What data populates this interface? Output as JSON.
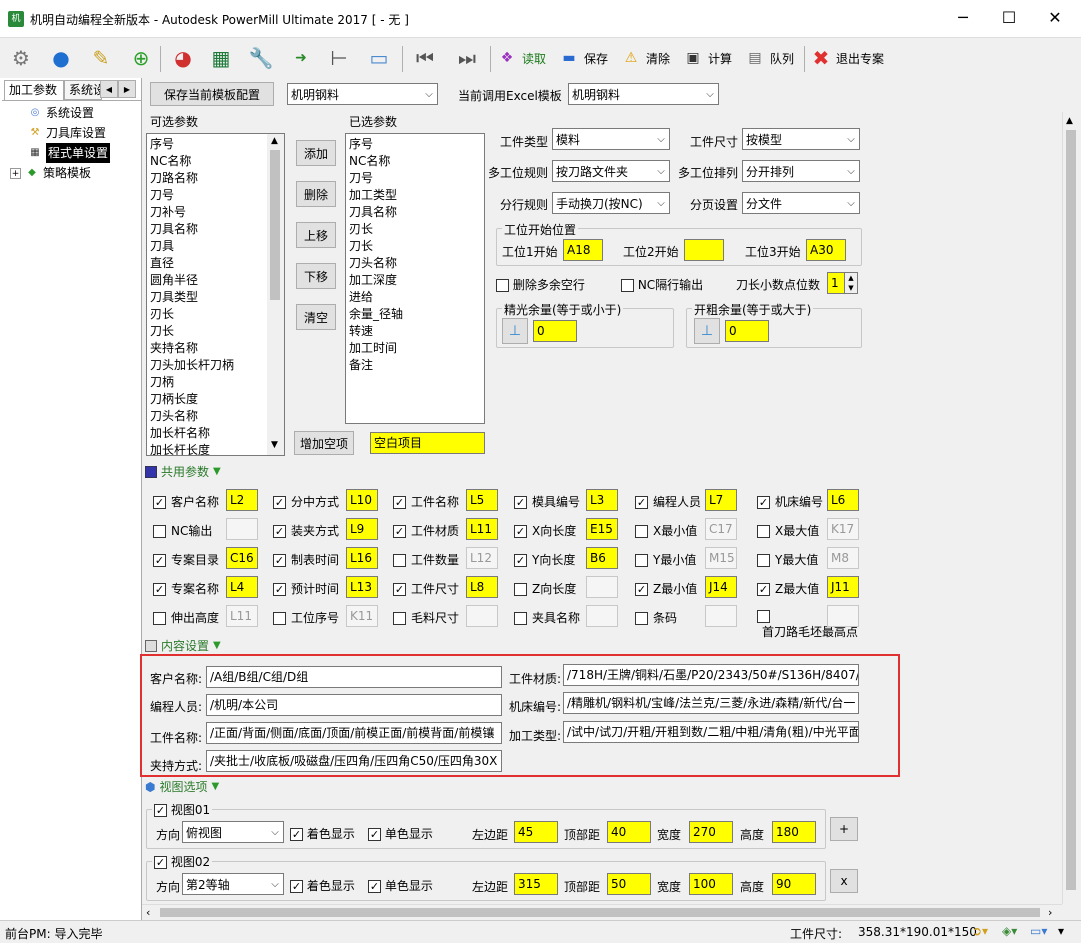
{
  "window": {
    "title": "机明自动编程全新版本 - Autodesk PowerMill Ultimate 2017 [ - 无 ]",
    "min": "─",
    "max": "☐",
    "close": "✕"
  },
  "toolbar": {
    "read": "读取",
    "save": "保存",
    "clear": "清除",
    "calc": "计算",
    "queue": "队列",
    "exit": "退出专案"
  },
  "left": {
    "tabs": [
      "加工参数",
      "系统设"
    ],
    "tree": [
      "系统设置",
      "刀具库设置",
      "程式单设置",
      "策略模板"
    ]
  },
  "top": {
    "save_btn": "保存当前模板配置",
    "template": "机明钢料",
    "excel_label": "当前调用Excel模板",
    "excel_value": "机明钢料"
  },
  "lists": {
    "avail_label": "可选参数",
    "sel_label": "已选参数",
    "available": [
      "序号",
      "NC名称",
      "刀路名称",
      "刀号",
      "刀补号",
      "刀具名称",
      "刀具",
      "直径",
      "圆角半径",
      "刀具类型",
      "刃长",
      "刀长",
      "夹持名称",
      "刀头加长杆刀柄",
      "刀柄",
      "刀柄长度",
      "刀头名称",
      "加长杆名称",
      "加长杆长度"
    ],
    "selected": [
      "序号",
      "NC名称",
      "刀号",
      "加工类型",
      "刀具名称",
      "刃长",
      "刀长",
      "刀头名称",
      "加工深度",
      "进给",
      "余量_径轴",
      "转速",
      "加工时间",
      "备注"
    ],
    "buttons": [
      "添加",
      "删除",
      "上移",
      "下移",
      "清空"
    ],
    "add_blank": "增加空项",
    "blank_value": "空白项目"
  },
  "settings": {
    "work_type_l": "工件类型",
    "work_type": "模料",
    "work_size_l": "工件尺寸",
    "work_size": "按模型",
    "multi_rule_l": "多工位规则",
    "multi_rule": "按刀路文件夹",
    "multi_order_l": "多工位排列",
    "multi_order": "分开排列",
    "split_rule_l": "分行规则",
    "split_rule": "手动换刀(按NC)",
    "page_l": "分页设置",
    "page": "分文件",
    "station_title": "工位开始位置",
    "st1_l": "工位1开始",
    "st1": "A18",
    "st2_l": "工位2开始",
    "st2": "",
    "st3_l": "工位3开始",
    "st3": "A30",
    "del_blank": "删除多余空行",
    "nc_skip": "NC隔行输出",
    "decimals_l": "刀长小数点位数",
    "decimals": "1",
    "finish_title": "精光余量(等于或小于)",
    "finish": "0",
    "rough_title": "开粗余量(等于或大于)",
    "rough": "0"
  },
  "common": {
    "header": "共用参数",
    "rows": [
      [
        {
          "c": true,
          "l": "客户名称",
          "v": "L2",
          "y": true
        },
        {
          "c": true,
          "l": "分中方式",
          "v": "L10",
          "y": true
        },
        {
          "c": true,
          "l": "工件名称",
          "v": "L5",
          "y": true
        },
        {
          "c": true,
          "l": "模具编号",
          "v": "L3",
          "y": true
        },
        {
          "c": true,
          "l": "编程人员",
          "v": "L7",
          "y": true
        },
        {
          "c": true,
          "l": "机床编号",
          "v": "L6",
          "y": true
        }
      ],
      [
        {
          "c": false,
          "l": "NC输出",
          "v": "",
          "y": false
        },
        {
          "c": true,
          "l": "装夹方式",
          "v": "L9",
          "y": true
        },
        {
          "c": true,
          "l": "工件材质",
          "v": "L11",
          "y": true
        },
        {
          "c": true,
          "l": "X向长度",
          "v": "E15",
          "y": true
        },
        {
          "c": false,
          "l": "X最小值",
          "v": "C17",
          "y": false
        },
        {
          "c": false,
          "l": "X最大值",
          "v": "K17",
          "y": false
        }
      ],
      [
        {
          "c": true,
          "l": "专案目录",
          "v": "C16",
          "y": true
        },
        {
          "c": true,
          "l": "制表时间",
          "v": "L16",
          "y": true
        },
        {
          "c": false,
          "l": "工件数量",
          "v": "L12",
          "y": false
        },
        {
          "c": true,
          "l": "Y向长度",
          "v": "B6",
          "y": true
        },
        {
          "c": false,
          "l": "Y最小值",
          "v": "M15",
          "y": false
        },
        {
          "c": false,
          "l": "Y最大值",
          "v": "M8",
          "y": false
        }
      ],
      [
        {
          "c": true,
          "l": "专案名称",
          "v": "L4",
          "y": true
        },
        {
          "c": true,
          "l": "预计时间",
          "v": "L13",
          "y": true
        },
        {
          "c": true,
          "l": "工件尺寸",
          "v": "L8",
          "y": true
        },
        {
          "c": false,
          "l": "Z向长度",
          "v": "",
          "y": false
        },
        {
          "c": true,
          "l": "Z最小值",
          "v": "J14",
          "y": true
        },
        {
          "c": true,
          "l": "Z最大值",
          "v": "J11",
          "y": true
        }
      ],
      [
        {
          "c": false,
          "l": "伸出高度",
          "v": "L11",
          "y": false
        },
        {
          "c": false,
          "l": "工位序号",
          "v": "K11",
          "y": false
        },
        {
          "c": false,
          "l": "毛料尺寸",
          "v": "",
          "y": false
        },
        {
          "c": false,
          "l": "夹具名称",
          "v": "",
          "y": false
        },
        {
          "c": false,
          "l": "条码",
          "v": "",
          "y": false
        },
        {
          "c": false,
          "l": "首刀路毛坯最高点",
          "v": "",
          "y": false
        }
      ]
    ]
  },
  "content": {
    "header": "内容设置",
    "cust_l": "客户名称:",
    "cust": "/A组/B组/C组/D组",
    "prog_l": "编程人员:",
    "prog": "/机明/本公司",
    "part_l": "工件名称:",
    "part": "/正面/背面/侧面/底面/顶面/前模正面/前模背面/前模镶",
    "clamp_l": "夹持方式:",
    "clamp": "/夹批士/收底板/吸磁盘/压四角/压四角C50/压四角30X",
    "mat_l": "工件材质:",
    "mat": "/718H/王牌/铜料/石墨/P20/2343/50#/S136H/8407/S",
    "mach_l": "机床编号:",
    "mach": "/精雕机/钢料机/宝峰/法兰克/三菱/永进/森精/新代/台一",
    "proc_l": "加工类型:",
    "proc": "/试中/试刀/开粗/开粗到数/二粗/中粗/清角(粗)/中光平面"
  },
  "view": {
    "header": "视图选项",
    "views": [
      {
        "name": "视图01",
        "dir": "俯视图",
        "color": "着色显示",
        "mono": "单色显示",
        "left": "45",
        "top": "40",
        "w": "270",
        "h": "180",
        "btn": "+"
      },
      {
        "name": "视图02",
        "dir": "第2等轴",
        "color": "着色显示",
        "mono": "单色显示",
        "left": "315",
        "top": "50",
        "w": "100",
        "h": "90",
        "btn": "x"
      }
    ],
    "dir_l": "方向",
    "left_l": "左边距",
    "top_l": "顶部距",
    "w_l": "宽度",
    "h_l": "高度"
  },
  "status": {
    "left": "前台PM: 导入完毕",
    "right_l": "工件尺寸:",
    "right": "358.31*190.01*150"
  },
  "colors": {
    "yellow": "#ffff00",
    "red": "#e03030",
    "green": "#2a9a2a"
  }
}
